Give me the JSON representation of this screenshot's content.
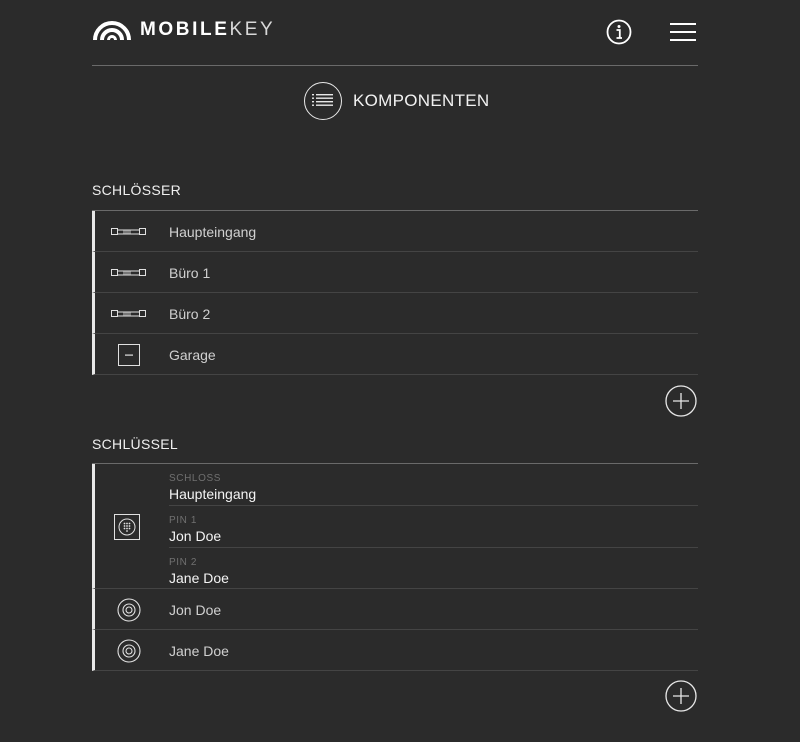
{
  "app": {
    "logo_light": "MOBILE",
    "logo_bold": "KEY"
  },
  "page": {
    "title": "KOMPONENTEN"
  },
  "locks": {
    "title": "SCHLÖSSER",
    "items": [
      {
        "label": "Haupteingang",
        "icon": "lock-cylinder-icon"
      },
      {
        "label": "Büro 1",
        "icon": "lock-cylinder-icon"
      },
      {
        "label": "Büro 2",
        "icon": "lock-cylinder-icon"
      },
      {
        "label": "Garage",
        "icon": "garage-lock-icon"
      }
    ]
  },
  "keys": {
    "title": "SCHLÜSSEL",
    "keypad": {
      "lock_caption": "SCHLOSS",
      "lock_value": "Haupteingang",
      "pin1_caption": "PIN 1",
      "pin1_value": "Jon Doe",
      "pin2_caption": "PIN 2",
      "pin2_value": "Jane Doe"
    },
    "items": [
      {
        "label": "Jon Doe",
        "icon": "transponder-icon"
      },
      {
        "label": "Jane Doe",
        "icon": "transponder-icon"
      }
    ]
  },
  "colors": {
    "background": "#2b2b2b",
    "text": "#e8e8e8",
    "divider": "#444444"
  }
}
